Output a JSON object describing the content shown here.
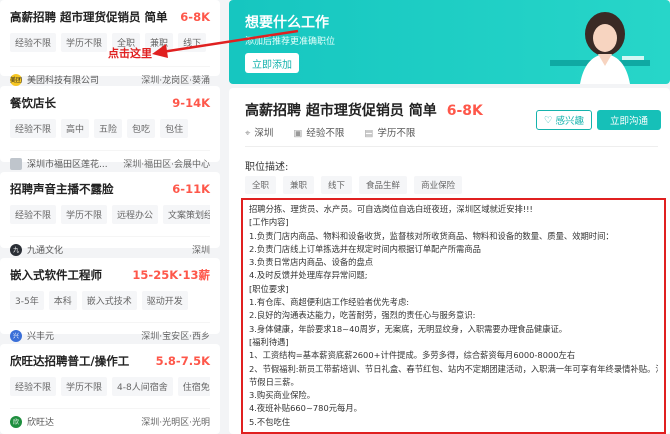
{
  "job_list": [
    {
      "title": "高薪招聘 超市理货促销员 简单",
      "salary": "6-8K",
      "tags": [
        "经验不限",
        "学历不限",
        "全职",
        "兼职",
        "线下"
      ],
      "company": "美团科技有限公司",
      "location": "深圳·龙岗区·葵涌",
      "logo_text": "美团",
      "logo_color": "#f6c623"
    },
    {
      "title": "餐饮店长",
      "salary": "9-14K",
      "tags": [
        "经验不限",
        "高中",
        "五险",
        "包吃",
        "包住"
      ],
      "company": "深圳市福田区莲花...",
      "location": "深圳·福田区·会展中心",
      "logo_text": "",
      "logo_color": "#bfc5cc"
    },
    {
      "title": "招聘声音主播不露脸",
      "salary": "6-11K",
      "tags": [
        "经验不限",
        "学历不限",
        "远程办公",
        "文案策划经验"
      ],
      "company": "九通文化",
      "location": "深圳",
      "logo_text": "九",
      "logo_color": "#2b2f36"
    },
    {
      "title": "嵌入式软件工程师",
      "salary": "15-25K·13薪",
      "tags": [
        "3-5年",
        "本科",
        "嵌入式技术",
        "驱动开发"
      ],
      "company": "兴丰元",
      "location": "深圳·宝安区·西乡",
      "logo_text": "兴",
      "logo_color": "#3a6fd8"
    },
    {
      "title": "欣旺达招聘普工/操作工",
      "salary": "5.8-7.5K",
      "tags": [
        "经验不限",
        "学历不限",
        "4-8人间宿舍",
        "住宿免费"
      ],
      "company": "欣旺达",
      "location": "深圳·光明区·光明",
      "logo_text": "欣",
      "logo_color": "#1e8e3e"
    }
  ],
  "annotation": {
    "text": "点击这里"
  },
  "banner": {
    "title": "想要什么工作",
    "subtitle": "添加后推荐更准确职位",
    "button": "立即添加"
  },
  "detail": {
    "title": "高薪招聘 超市理货促销员 简单",
    "salary": "6-8K",
    "location": "深圳",
    "experience": "经验不限",
    "education": "学历不限",
    "interest_button": "感兴趣",
    "chat_button": "立即沟通",
    "desc_label": "职位描述:",
    "tags": [
      "全职",
      "兼职",
      "线下",
      "食品生鲜",
      "商业保险"
    ],
    "description": [
      "招聘分拣、理货员、水产员。可自选岗位自选白班夜班，深圳区域就近安排!!!",
      "[工作内容]",
      "1.负责门店内商品、物料和设备收货，监督核对所收货商品、物料和设备的数量、质量、效期时间：",
      "2.负责门店线上订单拣选并在规定时间内根据订单配产所需商品",
      "3.负责日常店内商品、设备的盘点",
      "4.及时反馈并处理库存异常问题;",
      "[职位要求]",
      "1.有仓库、商超便利店工作经验者优先考虑:",
      "2.良好的沟通表达能力，吃苦耐劳，强烈的责任心与服务意识:",
      "3.身体健康，年龄要求18~40周岁，无案底，无明显纹身，入职需要办理食品健康证。",
      "[福利待遇]",
      "1、工资结构=基本薪资底薪2600+计件提成。多劳多得，综合薪资每月6000-8000左右",
      "2、节假福利:新员工带薪培训、节日礼盒、春节红包、站内不定期团建活动，入职满一年可享有年终录情补贴。法定",
      "节假日三薪。",
      "3.购买商业保险。",
      "4.夜班补贴660~780元每月。",
      "5.不包吃住"
    ]
  }
}
